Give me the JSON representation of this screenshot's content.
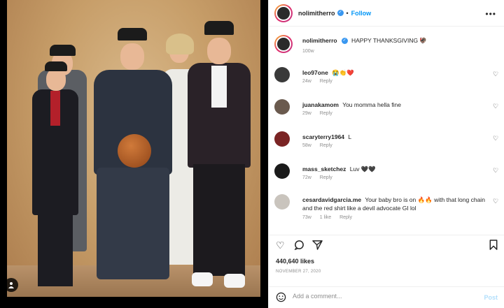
{
  "header": {
    "username": "nolimitherro",
    "follow_label": "Follow",
    "dot": "•",
    "more_icon": "more-icon"
  },
  "caption": {
    "username": "nolimitherro",
    "text": "HAPPY THANKSGIVING 🦃",
    "time": "100w"
  },
  "comments": [
    {
      "username": "leo97one",
      "text": "😭👏❤️",
      "time": "24w",
      "reply": "Reply",
      "likes": "",
      "avatar_color": "#3a3a3a"
    },
    {
      "username": "juanakamom",
      "text": "You momma hella fine",
      "time": "29w",
      "reply": "Reply",
      "likes": "",
      "avatar_color": "#6a5a4e"
    },
    {
      "username": "scaryterry1964",
      "text": "L",
      "time": "58w",
      "reply": "Reply",
      "likes": "",
      "avatar_color": "#7a2424"
    },
    {
      "username": "mass_sketchez",
      "text": "Luv 🖤🖤",
      "time": "72w",
      "reply": "Reply",
      "likes": "",
      "avatar_color": "#1a1a1a"
    },
    {
      "username": "cesardavidgarcia.me",
      "text": "Your baby bro is on 🔥🔥 with that long chain and the red shirt like a devil advocate GI lol",
      "time": "73w",
      "reply": "Reply",
      "likes": "1 like",
      "avatar_color": "#c9c4bd"
    }
  ],
  "actions": {
    "like_icon": "heart-icon",
    "comment_icon": "comment-icon",
    "share_icon": "share-icon",
    "save_icon": "bookmark-icon"
  },
  "likes": "440,640 likes",
  "date": "NOVEMBER 27, 2020",
  "add_comment": {
    "placeholder": "Add a comment...",
    "post_label": "Post"
  },
  "colors": {
    "link_blue": "#0095f6",
    "muted": "#8e8e8e",
    "verified": "#3897f0"
  }
}
